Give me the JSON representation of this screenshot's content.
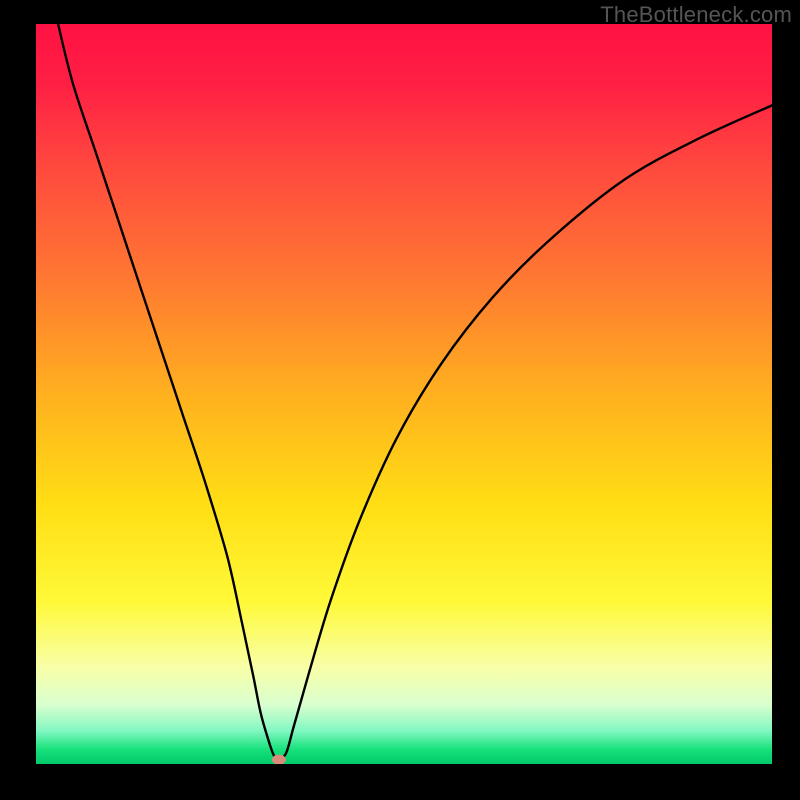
{
  "watermark": "TheBottleneck.com",
  "chart_data": {
    "type": "line",
    "title": "",
    "xlabel": "",
    "ylabel": "",
    "xlim": [
      0,
      100
    ],
    "ylim": [
      0,
      100
    ],
    "grid": false,
    "legend": false,
    "background": {
      "type": "vertical-gradient",
      "stops": [
        {
          "pos": 0.0,
          "color": "#ff1243"
        },
        {
          "pos": 0.08,
          "color": "#ff1f44"
        },
        {
          "pos": 0.2,
          "color": "#ff4b3e"
        },
        {
          "pos": 0.35,
          "color": "#ff7a31"
        },
        {
          "pos": 0.5,
          "color": "#ffb01f"
        },
        {
          "pos": 0.65,
          "color": "#ffde14"
        },
        {
          "pos": 0.78,
          "color": "#fff938"
        },
        {
          "pos": 0.87,
          "color": "#f8ffa8"
        },
        {
          "pos": 0.92,
          "color": "#d9ffcf"
        },
        {
          "pos": 0.955,
          "color": "#83f7c2"
        },
        {
          "pos": 0.98,
          "color": "#18e27c"
        },
        {
          "pos": 1.0,
          "color": "#00c96a"
        }
      ]
    },
    "series": [
      {
        "name": "bottleneck-curve",
        "color": "#000000",
        "x": [
          3,
          5,
          8,
          11,
          14,
          17,
          20,
          23,
          26,
          28,
          29.5,
          30.5,
          31.5,
          32.3,
          33,
          34,
          35,
          37,
          40,
          44,
          49,
          55,
          62,
          70,
          80,
          90,
          100
        ],
        "y": [
          100,
          92,
          83,
          74,
          65,
          56,
          47,
          38,
          28,
          19,
          12,
          7,
          3.5,
          1.2,
          0.6,
          1.5,
          5,
          12,
          22,
          33,
          44,
          54,
          63,
          71,
          79,
          84.5,
          89
        ]
      }
    ],
    "marker": {
      "name": "optimum-point",
      "x": 33,
      "y": 0.6,
      "color": "#d98c7a",
      "rx": 7,
      "ry": 5
    }
  }
}
